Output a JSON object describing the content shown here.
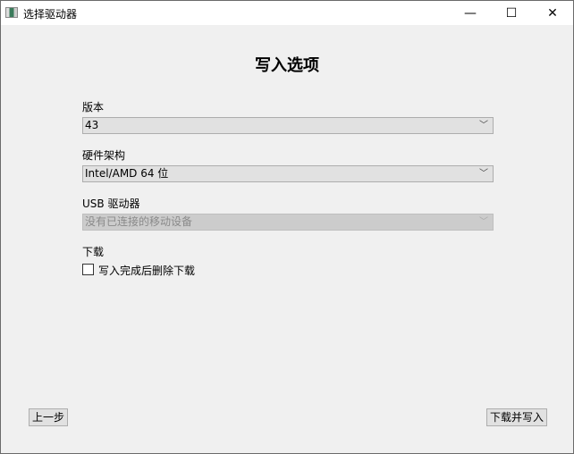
{
  "window": {
    "title": "选择驱动器",
    "minimize": "—",
    "maximize": "☐",
    "close": "✕"
  },
  "heading": "写入选项",
  "version": {
    "label": "版本",
    "value": "43"
  },
  "arch": {
    "label": "硬件架构",
    "value": "Intel/AMD 64 位"
  },
  "usb": {
    "label": "USB 驱动器",
    "value": "没有已连接的移动设备",
    "disabled": true
  },
  "download": {
    "label": "下载",
    "checkbox_label": "写入完成后删除下载",
    "checked": false
  },
  "buttons": {
    "back": "上一步",
    "write": "下载并写入"
  },
  "chevron": "﹀"
}
